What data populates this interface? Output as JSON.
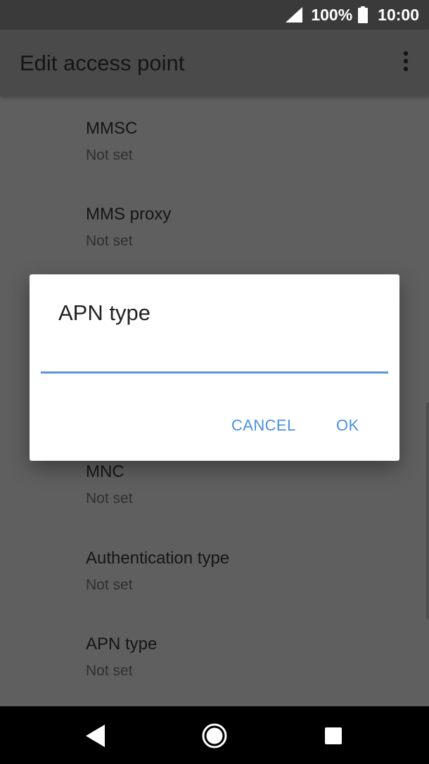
{
  "status_bar": {
    "battery_percent": "100%",
    "time": "10:00",
    "icons": [
      "signal-icon",
      "battery-icon"
    ]
  },
  "app_bar": {
    "title": "Edit access point",
    "menu_icon": "overflow-menu-icon"
  },
  "settings": [
    {
      "title": "MMSC",
      "summary": "Not set"
    },
    {
      "title": "MMS proxy",
      "summary": "Not set"
    },
    {
      "title": "MNC",
      "summary": "Not set"
    },
    {
      "title": "Authentication type",
      "summary": "Not set"
    },
    {
      "title": "APN type",
      "summary": "Not set"
    }
  ],
  "dialog": {
    "title": "APN type",
    "input_value": "",
    "cancel_label": "CANCEL",
    "ok_label": "OK"
  },
  "nav_bar": {
    "icons": [
      "back-icon",
      "home-icon",
      "recents-icon"
    ]
  },
  "colors": {
    "accent": "#4a90e2",
    "scrim_background": "#5f5f5f",
    "dialog_background": "#ffffff"
  }
}
